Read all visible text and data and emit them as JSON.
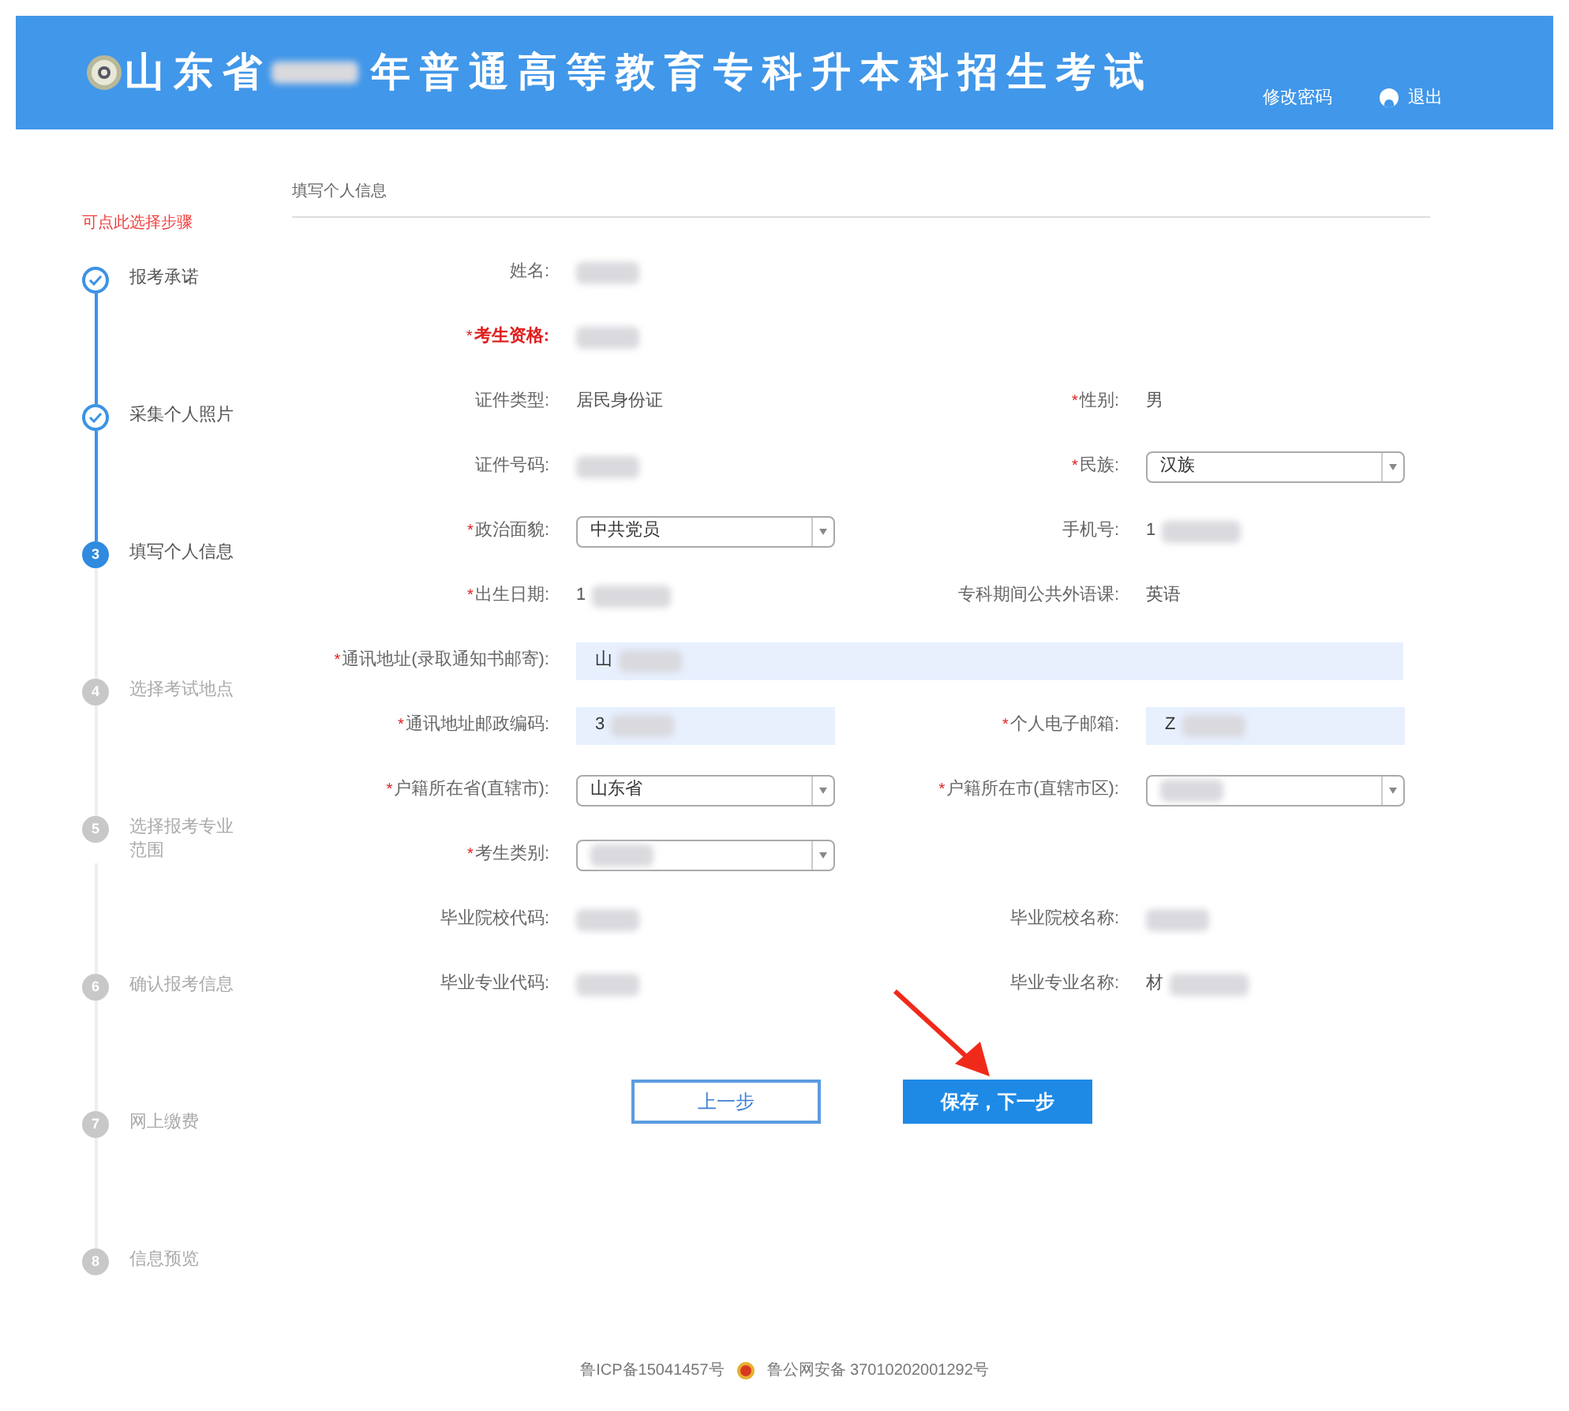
{
  "header": {
    "title_prefix": "山东省",
    "title_suffix": "年普通高等教育专科升本科招生考试",
    "links": [
      {
        "label": "修改密码",
        "kind": "plain"
      },
      {
        "label": "退出",
        "kind": "user"
      }
    ]
  },
  "sidebar": {
    "hint": "可点此选择步骤",
    "steps": [
      {
        "label": "报考承诺",
        "completed": true,
        "selected": false
      },
      {
        "label": "采集个人照片",
        "completed": true,
        "selected": false
      },
      {
        "label": "填写个人信息",
        "number": "3",
        "completed": false,
        "selected": true
      },
      {
        "label": "选择考试地点",
        "number": "4",
        "completed": false,
        "selected": false
      },
      {
        "label": "选择报考专业范围",
        "number": "5",
        "completed": false,
        "selected": false
      },
      {
        "label": "确认报考信息",
        "number": "6",
        "completed": false,
        "selected": false
      },
      {
        "label": "网上缴费",
        "number": "7",
        "completed": false,
        "selected": false
      },
      {
        "label": "信息预览",
        "number": "8",
        "completed": false,
        "selected": false
      }
    ]
  },
  "form": {
    "section_title": "填写个人信息",
    "rows": [
      {
        "fields": [
          {
            "label": "姓名:",
            "emphasis": false,
            "kind": "text",
            "redacted": true
          }
        ]
      },
      {
        "fields": [
          {
            "required_mark": "*",
            "label": "考生资格:",
            "emphasis": true,
            "kind": "text",
            "redacted": true
          }
        ]
      },
      {
        "fields": [
          {
            "label": "证件类型:",
            "emphasis": false,
            "kind": "text",
            "value": "居民身份证",
            "redacted": false
          },
          {
            "required_mark": "*",
            "label": "性别:",
            "emphasis": false,
            "kind": "text",
            "value": "男",
            "redacted": false
          }
        ]
      },
      {
        "fields": [
          {
            "label": "证件号码:",
            "emphasis": false,
            "kind": "text",
            "redacted": true
          },
          {
            "required_mark": "*",
            "label": "民族:",
            "emphasis": false,
            "kind": "select",
            "value": "汉族",
            "redacted": false
          }
        ]
      },
      {
        "fields": [
          {
            "required_mark": "*",
            "label": "政治面貌:",
            "emphasis": false,
            "kind": "select",
            "value": "中共党员",
            "redacted": false
          },
          {
            "label": "手机号:",
            "emphasis": false,
            "kind": "text",
            "value": "1",
            "redacted": true
          }
        ]
      },
      {
        "fields": [
          {
            "required_mark": "*",
            "label": "出生日期:",
            "emphasis": false,
            "kind": "text",
            "value": "1",
            "redacted": true
          },
          {
            "label": "专科期间公共外语课:",
            "emphasis": false,
            "kind": "text",
            "value": "英语",
            "redacted": false
          }
        ]
      },
      {
        "fields": [
          {
            "required_mark": "*",
            "label": "通讯地址(录取通知书邮寄):",
            "emphasis": false,
            "kind": "input",
            "value": "山",
            "redacted": true,
            "wide": true
          }
        ]
      },
      {
        "fields": [
          {
            "required_mark": "*",
            "label": "通讯地址邮政编码:",
            "emphasis": false,
            "kind": "input",
            "value": "3",
            "redacted": true
          },
          {
            "required_mark": "*",
            "label": "个人电子邮箱:",
            "emphasis": false,
            "kind": "input",
            "value": "Z",
            "redacted": true
          }
        ]
      },
      {
        "fields": [
          {
            "required_mark": "*",
            "label": "户籍所在省(直辖市):",
            "emphasis": false,
            "kind": "select",
            "value": "山东省",
            "redacted": false
          },
          {
            "required_mark": "*",
            "label": "户籍所在市(直辖市区):",
            "emphasis": false,
            "kind": "select",
            "redacted": true
          }
        ]
      },
      {
        "fields": [
          {
            "required_mark": "*",
            "label": "考生类别:",
            "emphasis": false,
            "kind": "select",
            "redacted": true
          }
        ]
      },
      {
        "fields": [
          {
            "label": "毕业院校代码:",
            "emphasis": false,
            "kind": "text",
            "redacted": true
          },
          {
            "label": "毕业院校名称:",
            "emphasis": false,
            "kind": "text",
            "redacted": true
          }
        ]
      },
      {
        "fields": [
          {
            "label": "毕业专业代码:",
            "emphasis": false,
            "kind": "text",
            "redacted": true
          },
          {
            "label": "毕业专业名称:",
            "emphasis": false,
            "kind": "text",
            "value": "材",
            "redacted": true
          }
        ]
      }
    ],
    "buttons": [
      {
        "label": "上一步",
        "kind": "secondary"
      },
      {
        "label": "保存，下一步",
        "kind": "primary"
      }
    ]
  },
  "footer": {
    "icp": "鲁ICP备15041457号",
    "police": "鲁公网安备 37010202001292号"
  }
}
